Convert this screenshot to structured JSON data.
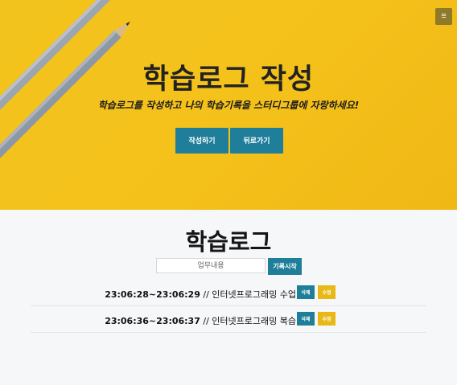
{
  "hero": {
    "menu_icon": "≡",
    "title": "학습로그 작성",
    "subtitle": "학습로그를 작성하고 나의 학습기록을 스터디그룹에 자랑하세요!",
    "write_button": "작성하기",
    "back_button": "뒤로가기"
  },
  "log": {
    "title": "학습로그",
    "input_placeholder": "업무내용",
    "start_button": "기록시작",
    "entries": [
      {
        "start": "23:06:28",
        "end": "23:06:29",
        "task": "인터넷프로그래밍 수업",
        "delete": "삭제",
        "edit": "수정"
      },
      {
        "start": "23:06:36",
        "end": "23:06:37",
        "task": "인터넷프로그래밍 복습",
        "delete": "삭제",
        "edit": "수정"
      }
    ]
  },
  "colors": {
    "accent_blue": "#1f7e9a",
    "accent_yellow": "#e8b816",
    "hero_bg": "#f2c31d"
  }
}
